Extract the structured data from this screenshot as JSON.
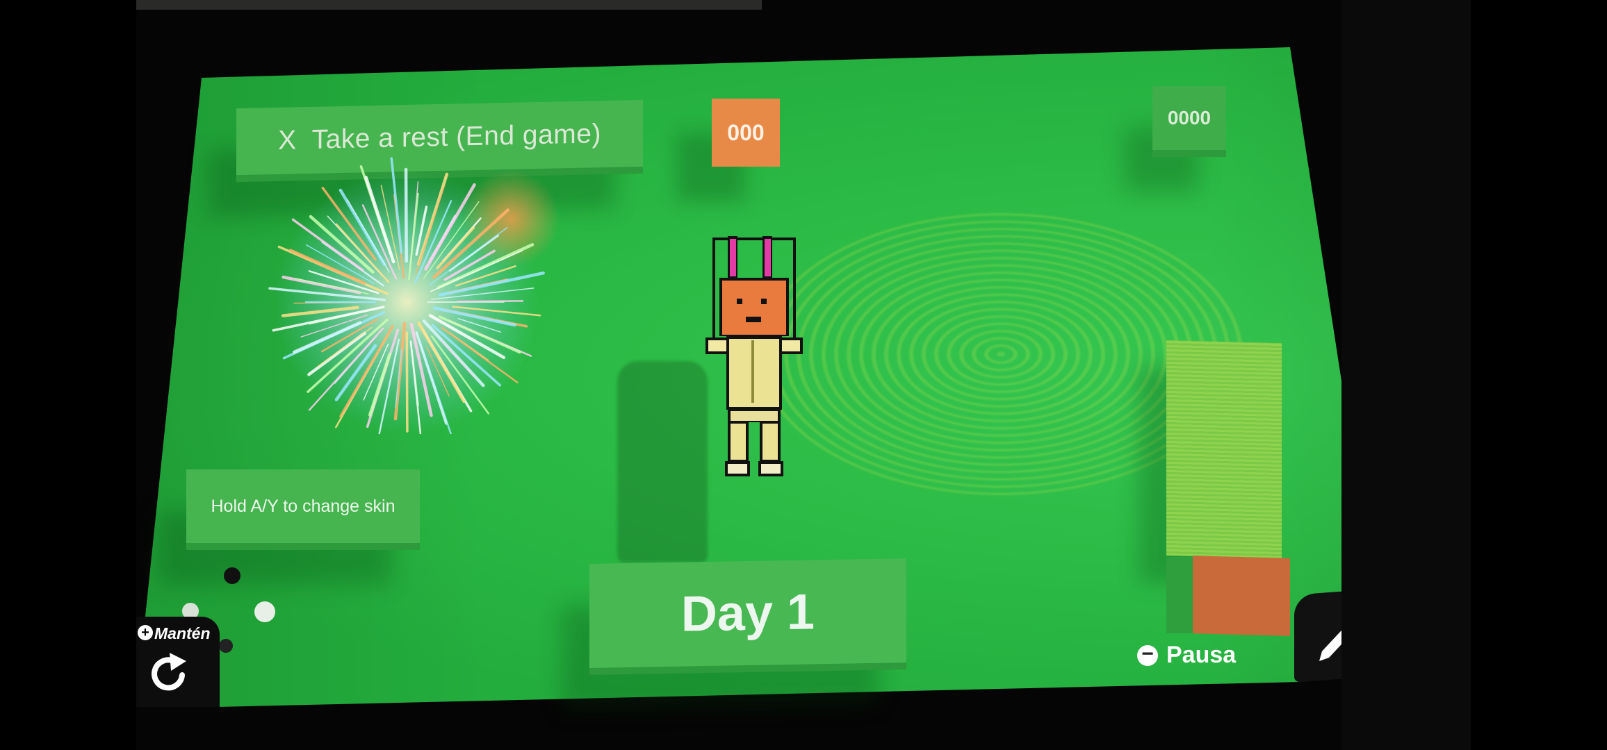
{
  "game": {
    "end_game_label": "Take a rest (End game)",
    "close_glyph": "X",
    "score_orange": "000",
    "score_green": "0000",
    "skin_hint": "Hold A/Y to change skin",
    "day_label": "Day 1"
  },
  "system_overlay": {
    "hold_label": "Mantén",
    "hold_plus": "+",
    "pause_label": "Pausa",
    "pause_minus": "−",
    "edit_plus": "+"
  },
  "colors": {
    "background": "#2cbb46",
    "accent_orange": "#e88a47",
    "bar_green": "#8fd34e",
    "bar_brown": "#c96a3a"
  },
  "icons": [
    "close-icon",
    "rotate-icon",
    "pencil-icon",
    "plus-icon",
    "minus-icon"
  ]
}
